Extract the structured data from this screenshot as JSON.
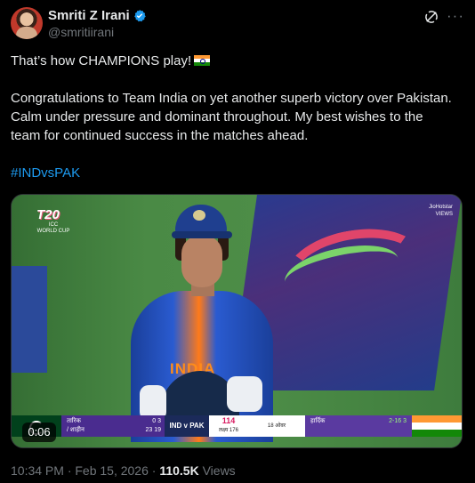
{
  "author": {
    "name": "Smriti Z Irani",
    "handle": "@smritiirani",
    "verified_icon": "verified-badge-icon",
    "accent": "#1d9bf0"
  },
  "post": {
    "line1": "That’s how CHAMPIONS play!",
    "line1_emoji": "india-flag",
    "paragraph": "Congratulations to Team India on yet another superb victory over Pakistan. Calm under pressure and dominant throughout. My best wishes to the team for continued success in the matches ahead.",
    "hashtag": "#INDvsPAK"
  },
  "media": {
    "video_time": "0:06",
    "jersey_text": "INDIA",
    "scorebar": {
      "batter1": "तारिक",
      "batter2": "/ शाहीन",
      "batter1_score": "0  3",
      "batter2_score": "23  19",
      "match": "IND v PAK",
      "score": "114",
      "target": "लक्ष्य 176",
      "over": "18 ओवर",
      "bowler": "हार्दिक",
      "bowler_figures": "2-16  3"
    }
  },
  "footer": {
    "timestamp": "10:34 PM · Feb 15, 2026 · ",
    "views_count": "110.5K",
    "views_label": " Views"
  }
}
